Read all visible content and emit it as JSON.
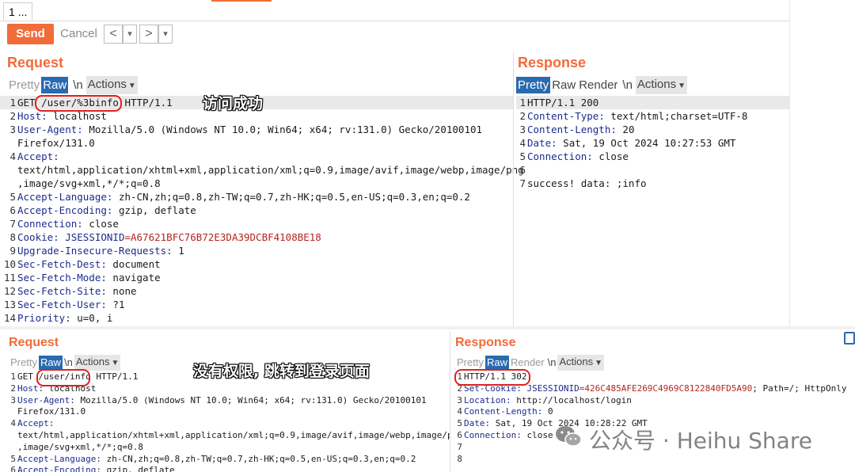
{
  "tab": {
    "index": "1",
    "more": "..."
  },
  "toolbar": {
    "send_label": "Send",
    "cancel_label": "Cancel",
    "back": "<",
    "forward": ">",
    "dropdown": "▾"
  },
  "top": {
    "request": {
      "title": "Request",
      "tabs": {
        "pretty": "Pretty",
        "raw": "Raw",
        "newline": "\\n",
        "actions": "Actions"
      },
      "lines": [
        {
          "n": "1",
          "segments": [
            {
              "t": "GET "
            },
            {
              "t": "/user/%3binfo"
            },
            {
              "t": " HTTP/1.1"
            }
          ]
        },
        {
          "n": "2",
          "segments": [
            {
              "t": "Host:",
              "c": "k"
            },
            {
              "t": " localhost"
            }
          ]
        },
        {
          "n": "3",
          "segments": [
            {
              "t": "User-Agent:",
              "c": "k"
            },
            {
              "t": " Mozilla/5.0 (Windows NT 10.0; Win64; x64; rv:131.0) Gecko/20100101"
            }
          ]
        },
        {
          "n": "",
          "segments": [
            {
              "t": "Firefox/131.0"
            }
          ]
        },
        {
          "n": "4",
          "segments": [
            {
              "t": "Accept:",
              "c": "k"
            }
          ]
        },
        {
          "n": "",
          "segments": [
            {
              "t": "text/html,application/xhtml+xml,application/xml;q=0.9,image/avif,image/webp,image/png"
            }
          ]
        },
        {
          "n": "",
          "segments": [
            {
              "t": ",image/svg+xml,*/*;q=0.8"
            }
          ]
        },
        {
          "n": "5",
          "segments": [
            {
              "t": "Accept-Language:",
              "c": "k"
            },
            {
              "t": " zh-CN,zh;q=0.8,zh-TW;q=0.7,zh-HK;q=0.5,en-US;q=0.3,en;q=0.2"
            }
          ]
        },
        {
          "n": "6",
          "segments": [
            {
              "t": "Accept-Encoding:",
              "c": "k"
            },
            {
              "t": " gzip, deflate"
            }
          ]
        },
        {
          "n": "7",
          "segments": [
            {
              "t": "Connection:",
              "c": "k"
            },
            {
              "t": " close"
            }
          ]
        },
        {
          "n": "8",
          "segments": [
            {
              "t": "Cookie:",
              "c": "k"
            },
            {
              "t": " JSESSIONID",
              "c": "k"
            },
            {
              "t": "=A67621BFC76B72E3DA39DCBF4108BE18",
              "c": "cookie"
            }
          ]
        },
        {
          "n": "9",
          "segments": [
            {
              "t": "Upgrade-Insecure-Requests:",
              "c": "k"
            },
            {
              "t": " 1"
            }
          ]
        },
        {
          "n": "10",
          "segments": [
            {
              "t": "Sec-Fetch-Dest:",
              "c": "k"
            },
            {
              "t": " document"
            }
          ]
        },
        {
          "n": "11",
          "segments": [
            {
              "t": "Sec-Fetch-Mode:",
              "c": "k"
            },
            {
              "t": " navigate"
            }
          ]
        },
        {
          "n": "12",
          "segments": [
            {
              "t": "Sec-Fetch-Site:",
              "c": "k"
            },
            {
              "t": " none"
            }
          ]
        },
        {
          "n": "13",
          "segments": [
            {
              "t": "Sec-Fetch-User:",
              "c": "k"
            },
            {
              "t": " ?1"
            }
          ]
        },
        {
          "n": "14",
          "segments": [
            {
              "t": "Priority:",
              "c": "k"
            },
            {
              "t": " u=0, i"
            }
          ]
        }
      ],
      "annotation": "访问成功"
    },
    "response": {
      "title": "Response",
      "tabs": {
        "pretty": "Pretty",
        "raw": "Raw",
        "render": "Render",
        "newline": "\\n",
        "actions": "Actions"
      },
      "lines": [
        {
          "n": "1",
          "segments": [
            {
              "t": "HTTP/1.1 200"
            }
          ]
        },
        {
          "n": "2",
          "segments": [
            {
              "t": "Content-Type:",
              "c": "k"
            },
            {
              "t": " text/html;charset=UTF-8"
            }
          ]
        },
        {
          "n": "3",
          "segments": [
            {
              "t": "Content-Length:",
              "c": "k"
            },
            {
              "t": " 20"
            }
          ]
        },
        {
          "n": "4",
          "segments": [
            {
              "t": "Date:",
              "c": "k"
            },
            {
              "t": " Sat, 19 Oct 2024 10:27:53 GMT"
            }
          ]
        },
        {
          "n": "5",
          "segments": [
            {
              "t": "Connection:",
              "c": "k"
            },
            {
              "t": " close"
            }
          ]
        },
        {
          "n": "6",
          "segments": []
        },
        {
          "n": "7",
          "segments": [
            {
              "t": "success! data: ;info"
            }
          ]
        }
      ]
    }
  },
  "bottom": {
    "request": {
      "title": "Request",
      "tabs": {
        "pretty": "Pretty",
        "raw": "Raw",
        "newline": "\\n",
        "actions": "Actions"
      },
      "lines": [
        {
          "n": "1",
          "segments": [
            {
              "t": "GET "
            },
            {
              "t": "/user/info"
            },
            {
              "t": " HTTP/1.1"
            }
          ]
        },
        {
          "n": "2",
          "segments": [
            {
              "t": "Host:",
              "c": "k"
            },
            {
              "t": " localhost"
            }
          ]
        },
        {
          "n": "3",
          "segments": [
            {
              "t": "User-Agent:",
              "c": "k"
            },
            {
              "t": " Mozilla/5.0 (Windows NT 10.0; Win64; x64; rv:131.0) Gecko/20100101"
            }
          ]
        },
        {
          "n": "",
          "segments": [
            {
              "t": "Firefox/131.0"
            }
          ]
        },
        {
          "n": "4",
          "segments": [
            {
              "t": "Accept:",
              "c": "k"
            }
          ]
        },
        {
          "n": "",
          "segments": [
            {
              "t": "text/html,application/xhtml+xml,application/xml;q=0.9,image/avif,image/webp,image/png"
            }
          ]
        },
        {
          "n": "",
          "segments": [
            {
              "t": ",image/svg+xml,*/*;q=0.8"
            }
          ]
        },
        {
          "n": "5",
          "segments": [
            {
              "t": "Accept-Language:",
              "c": "k"
            },
            {
              "t": " zh-CN,zh;q=0.8,zh-TW;q=0.7,zh-HK;q=0.5,en-US;q=0.3,en;q=0.2"
            }
          ]
        },
        {
          "n": "6",
          "segments": [
            {
              "t": "Accept-Encoding:",
              "c": "k"
            },
            {
              "t": " gzip, deflate"
            }
          ]
        }
      ],
      "annotation": "没有权限, 跳转到登录页面"
    },
    "response": {
      "title": "Response",
      "tabs": {
        "pretty": "Pretty",
        "raw": "Raw",
        "render": "Render",
        "newline": "\\n",
        "actions": "Actions"
      },
      "lines": [
        {
          "n": "1",
          "segments": [
            {
              "t": "HTTP/1.1 302"
            }
          ]
        },
        {
          "n": "2",
          "segments": [
            {
              "t": "Set-Cookie:",
              "c": "k"
            },
            {
              "t": " JSESSIONID",
              "c": "k"
            },
            {
              "t": "=426C485AFE269C4969C8122840FD5A90",
              "c": "cookie"
            },
            {
              "t": "; Path=/; HttpOnly"
            }
          ]
        },
        {
          "n": "3",
          "segments": [
            {
              "t": "Location:",
              "c": "k"
            },
            {
              "t": " http://localhost/login"
            }
          ]
        },
        {
          "n": "4",
          "segments": [
            {
              "t": "Content-Length:",
              "c": "k"
            },
            {
              "t": " 0"
            }
          ]
        },
        {
          "n": "5",
          "segments": [
            {
              "t": "Date:",
              "c": "k"
            },
            {
              "t": " Sat, 19 Oct 2024 10:28:22 GMT"
            }
          ]
        },
        {
          "n": "6",
          "segments": [
            {
              "t": "Connection:",
              "c": "k"
            },
            {
              "t": " close"
            }
          ]
        },
        {
          "n": "7",
          "segments": []
        },
        {
          "n": "8",
          "segments": []
        }
      ]
    }
  },
  "watermark": "公众号 · Heihu Share",
  "colors": {
    "accent": "#f26b3a",
    "selected_tab": "#2a6ab0",
    "header_key": "#1c2b8c",
    "cookie_value": "#b3261e",
    "annotation_box": "#e02020"
  }
}
